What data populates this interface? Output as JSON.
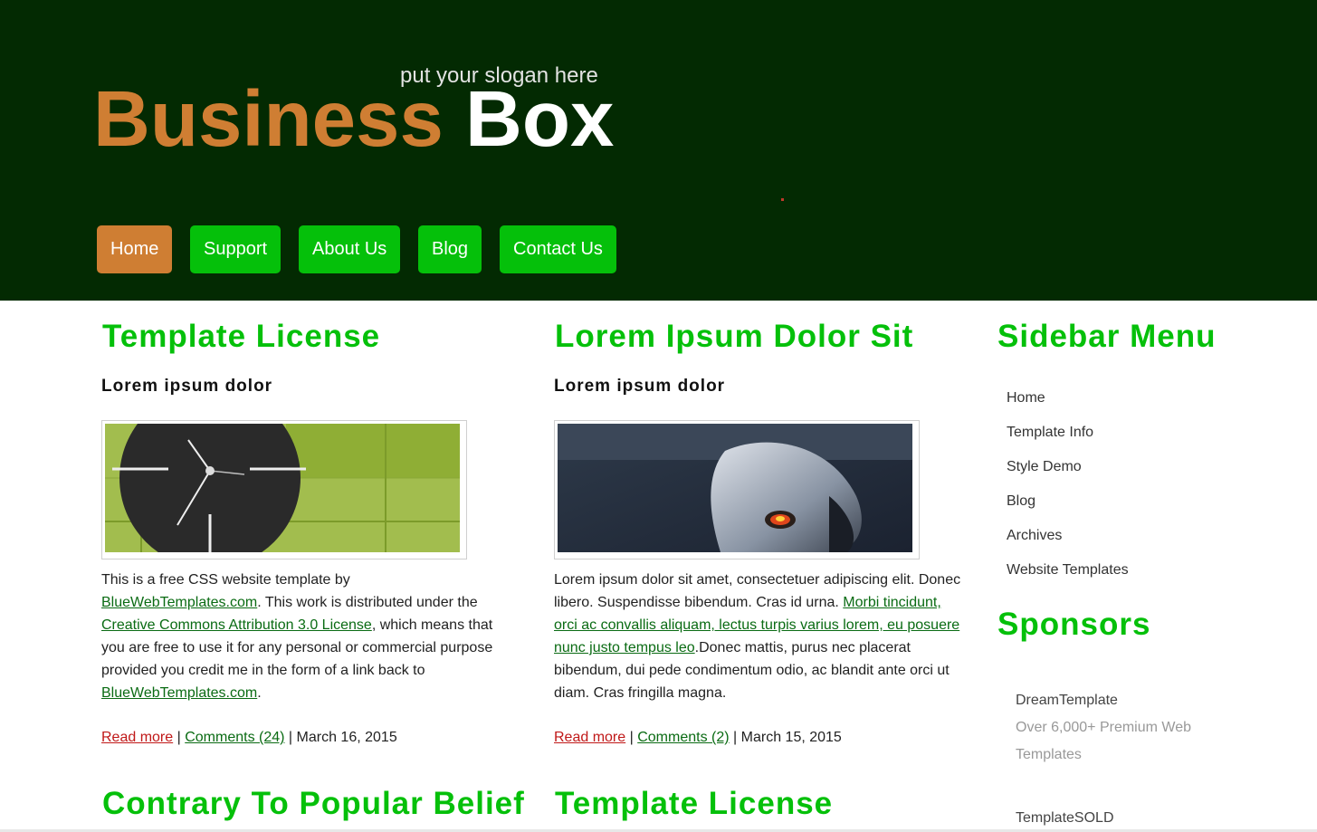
{
  "header": {
    "slogan": "put your slogan here",
    "logo_part1": "Business",
    "logo_part2": "Box"
  },
  "nav": {
    "items": [
      "Home",
      "Support",
      "About Us",
      "Blog",
      "Contact Us"
    ],
    "active": "Home"
  },
  "posts": [
    {
      "title": "Template License",
      "subtitle": "Lorem ipsum dolor",
      "image": "clock-image",
      "body": {
        "t1": "This is a free CSS website template by ",
        "l1": "BlueWebTemplates.com",
        "t2": ". This work is distributed under the ",
        "l2": "Creative Commons Attribution 3.0 License",
        "t3": ", which means that you are free to use it for any personal or commercial purpose provided you credit me in the form of a link back to ",
        "l3": "BlueWebTemplates.com",
        "t4": "."
      },
      "read_more": "Read more",
      "comments": "Comments (24)",
      "date": "March 16, 2015"
    },
    {
      "title": "Lorem Ipsum Dolor Sit",
      "subtitle": "Lorem ipsum dolor",
      "image": "mouse-image",
      "body": {
        "t1": "Lorem ipsum dolor sit amet, consectetuer adipiscing elit. Donec libero. Suspendisse bibendum. Cras id urna. ",
        "l1": "Morbi tincidunt, orci ac convallis aliquam, lectus turpis varius lorem, eu posuere nunc justo tempus leo",
        "t2": ".Donec mattis, purus nec placerat bibendum, dui pede condimentum odio, ac blandit ante orci ut diam. Cras fringilla magna."
      },
      "read_more": "Read more",
      "comments": "Comments (2)",
      "date": "March 15, 2015"
    }
  ],
  "next_posts": [
    "Contrary To Popular Belief",
    "Template License"
  ],
  "meta_sep": "|",
  "sidebar": {
    "title": "Sidebar Menu",
    "items": [
      "Home",
      "Template Info",
      "Style Demo",
      "Blog",
      "Archives",
      "Website Templates"
    ]
  },
  "sponsors": {
    "title": "Sponsors",
    "items": [
      {
        "name": "DreamTemplate",
        "desc": "Over 6,000+ Premium Web Templates"
      },
      {
        "name": "TemplateSOLD",
        "desc": ""
      }
    ]
  },
  "colors": {
    "header_bg": "#032a02",
    "accent_green": "#05c00a",
    "accent_orange": "#cf7e33",
    "link_green": "#0a6b13",
    "read_more_red": "#c01818"
  }
}
